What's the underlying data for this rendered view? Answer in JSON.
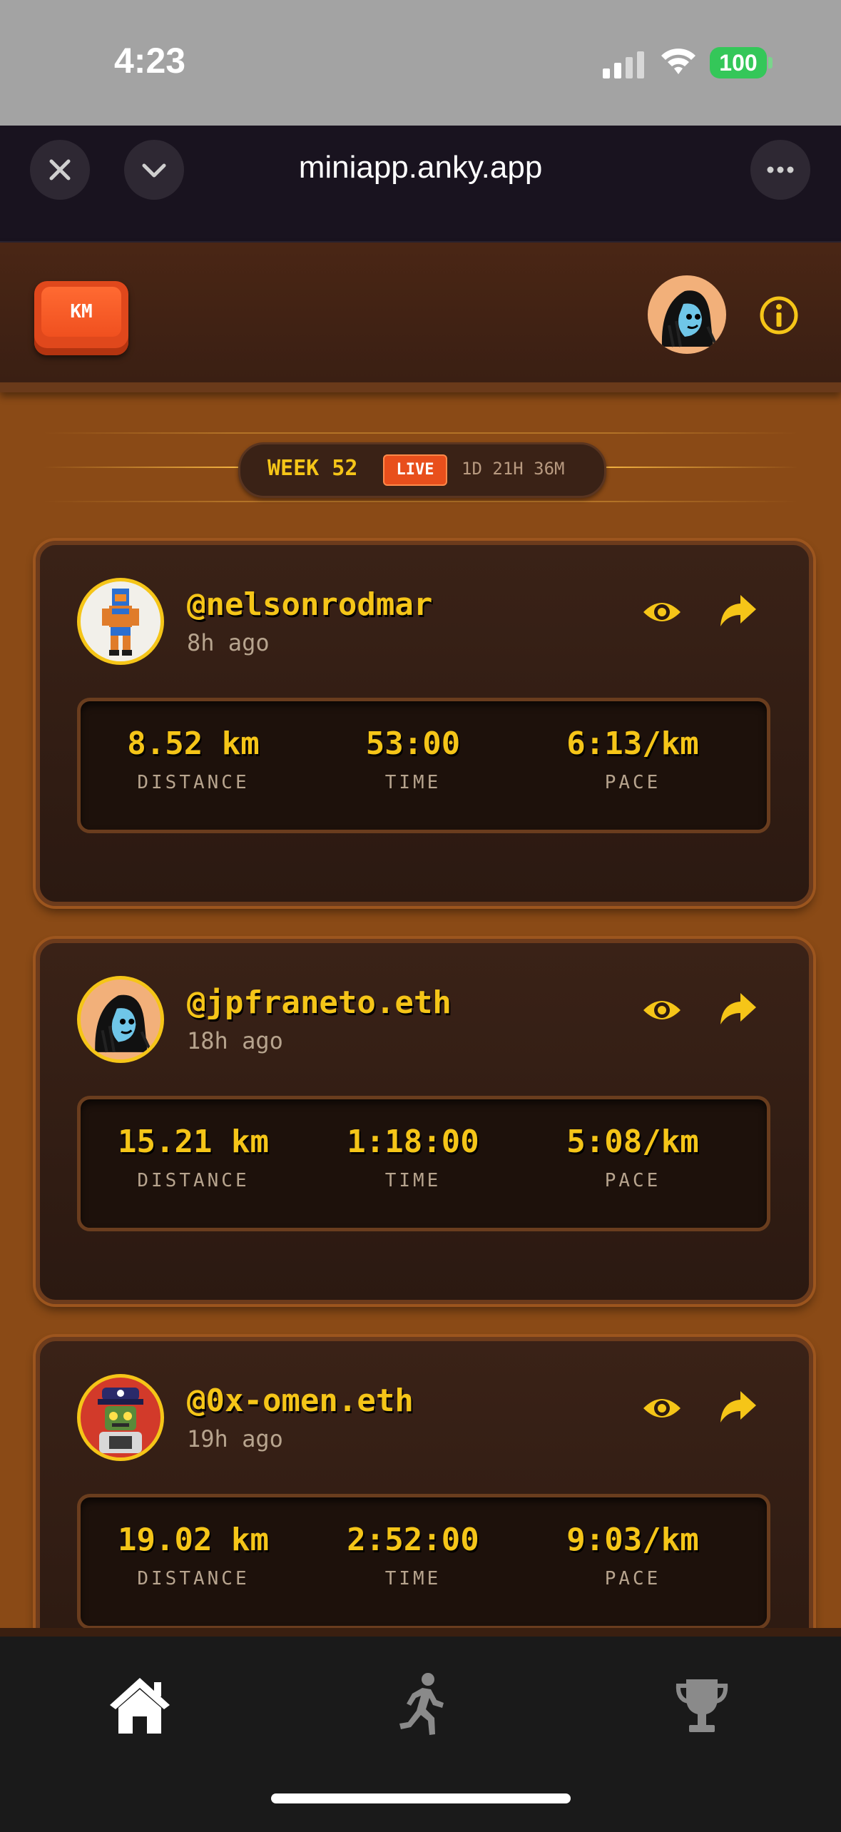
{
  "status_bar": {
    "time": "4:23",
    "battery": "100"
  },
  "browser": {
    "url": "miniapp.anky.app"
  },
  "header": {
    "unit_toggle": "KM"
  },
  "week": {
    "label": "WEEK 52",
    "live": "LIVE",
    "countdown": "1D 21H 36M"
  },
  "runs": [
    {
      "username": "@nelsonrodmar",
      "ago": "8h ago",
      "distance": "8.52 km",
      "time": "53:00",
      "pace": "6:13/km"
    },
    {
      "username": "@jpfraneto.eth",
      "ago": "18h ago",
      "distance": "15.21 km",
      "time": "1:18:00",
      "pace": "5:08/km"
    },
    {
      "username": "@0x-omen.eth",
      "ago": "19h ago",
      "distance": "19.02 km",
      "time": "2:52:00",
      "pace": "9:03/km"
    }
  ],
  "stat_labels": {
    "distance": "DISTANCE",
    "time": "TIME",
    "pace": "PACE"
  },
  "nav": [
    "home-icon",
    "runner-icon",
    "trophy-icon"
  ],
  "colors": {
    "accent": "#f5c518",
    "live": "#e84f1c",
    "background": "#8a4a16"
  }
}
